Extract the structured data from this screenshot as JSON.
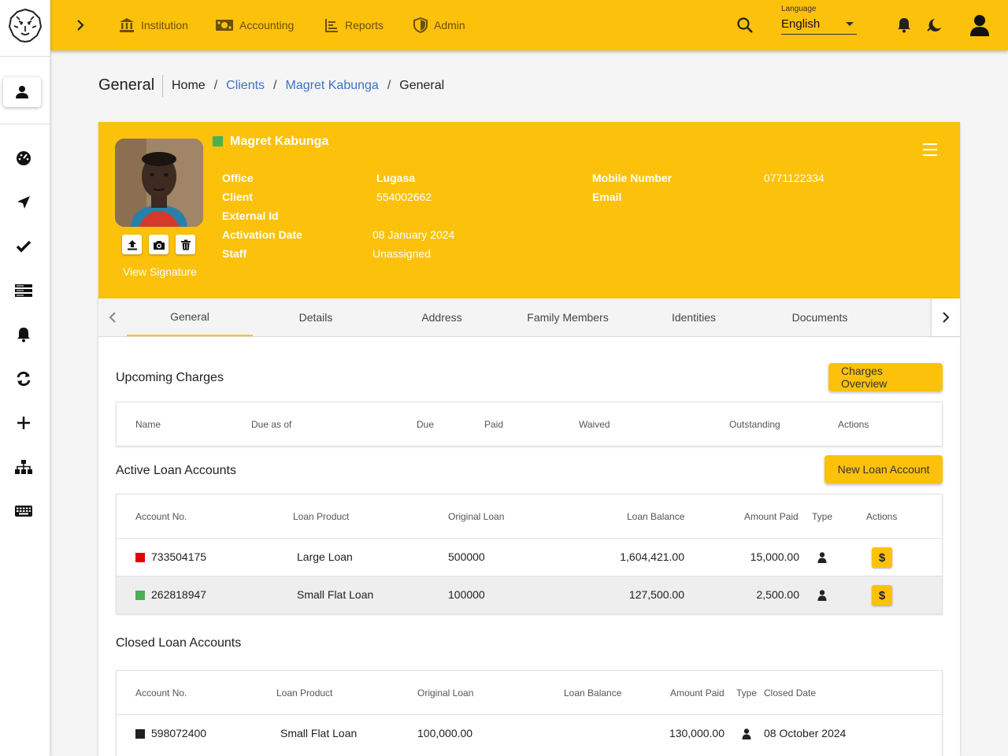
{
  "topnav": {
    "items": [
      {
        "label": "Institution",
        "icon": "bank-icon"
      },
      {
        "label": "Accounting",
        "icon": "money-icon"
      },
      {
        "label": "Reports",
        "icon": "reports-icon"
      },
      {
        "label": "Admin",
        "icon": "shield-icon"
      }
    ],
    "language_label": "Language",
    "language_value": "English"
  },
  "page": {
    "title": "General",
    "breadcrumb": {
      "home": "Home",
      "clients": "Clients",
      "client": "Magret Kabunga",
      "current": "General"
    }
  },
  "client": {
    "name": "Magret Kabunga",
    "status_color": "#4caf50",
    "view_signature": "View Signature",
    "fields": {
      "office_label": "Office",
      "office": "Lugasa",
      "client_label": "Client",
      "client": "554002662",
      "external_id_label": "External Id",
      "external_id": "",
      "activation_label": "Activation Date",
      "activation": "08 January 2024",
      "staff_label": "Staff",
      "staff": "Unassigned",
      "mobile_label": "Mobile Number",
      "mobile": "0771122334",
      "email_label": "Email",
      "email": ""
    }
  },
  "tabs": [
    "General",
    "Details",
    "Address",
    "Family Members",
    "Identities",
    "Documents"
  ],
  "upcoming_charges": {
    "title": "Upcoming Charges",
    "button": "Charges Overview",
    "columns": [
      "Name",
      "Due as of",
      "Due",
      "Paid",
      "Waived",
      "Outstanding",
      "Actions"
    ]
  },
  "active_loans": {
    "title": "Active Loan Accounts",
    "button": "New Loan Account",
    "columns": [
      "Account No.",
      "Loan Product",
      "Original Loan",
      "Loan Balance",
      "Amount Paid",
      "Type",
      "Actions"
    ],
    "rows": [
      {
        "account": "733504175",
        "status_color": "#e60000",
        "product": "Large Loan",
        "original": "500000",
        "balance": "1,604,421.00",
        "paid": "15,000.00",
        "action": "$"
      },
      {
        "account": "262818947",
        "status_color": "#4caf50",
        "product": "Small Flat Loan",
        "original": "100000",
        "balance": "127,500.00",
        "paid": "2,500.00",
        "action": "$"
      }
    ]
  },
  "closed_loans": {
    "title": "Closed Loan Accounts",
    "columns": [
      "Account No.",
      "Loan Product",
      "Original Loan",
      "Loan Balance",
      "Amount Paid",
      "Type",
      "Closed Date"
    ],
    "rows": [
      {
        "account": "598072400",
        "status_color": "#212121",
        "product": "Small Flat Loan",
        "original": "100,000.00",
        "balance": "",
        "paid": "130,000.00",
        "closed": "08 October 2024"
      }
    ]
  },
  "colors": {
    "accent": "#fcc10b",
    "link": "#3f6fcc"
  }
}
